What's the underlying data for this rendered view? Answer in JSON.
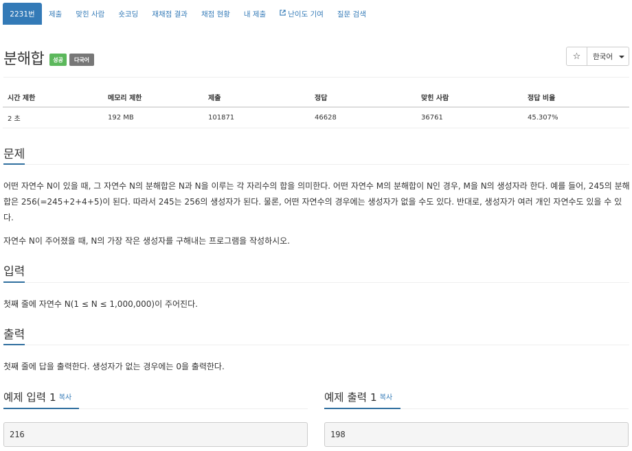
{
  "nav": {
    "items": [
      {
        "label": "2231번",
        "active": true
      },
      {
        "label": "제출"
      },
      {
        "label": "맞힌 사람"
      },
      {
        "label": "숏코딩"
      },
      {
        "label": "재채점 결과"
      },
      {
        "label": "채점 현황"
      },
      {
        "label": "내 제출"
      },
      {
        "label": "난이도 기여",
        "icon": "external-link-icon"
      },
      {
        "label": "질문 검색"
      }
    ]
  },
  "problem": {
    "title": "분해합",
    "badges": {
      "success": "성공",
      "multi": "다국어"
    },
    "star_icon": "☆",
    "language": "한국어"
  },
  "info": {
    "headers": [
      "시간 제한",
      "메모리 제한",
      "제출",
      "정답",
      "맞힌 사람",
      "정답 비율"
    ],
    "values": [
      "2 초",
      "192 MB",
      "101871",
      "46628",
      "36761",
      "45.307%"
    ]
  },
  "sections": {
    "problem_title": "문제",
    "problem_p1": "어떤 자연수 N이 있을 때, 그 자연수 N의 분해합은 N과 N을 이루는 각 자리수의 합을 의미한다. 어떤 자연수 M의 분해합이 N인 경우, M을 N의 생성자라 한다. 예를 들어, 245의 분해합은 256(=245+2+4+5)이 된다. 따라서 245는 256의 생성자가 된다. 물론, 어떤 자연수의 경우에는 생성자가 없을 수도 있다. 반대로, 생성자가 여러 개인 자연수도 있을 수 있다.",
    "problem_p2": "자연수 N이 주어졌을 때, N의 가장 작은 생성자를 구해내는 프로그램을 작성하시오.",
    "input_title": "입력",
    "input_text": "첫째 줄에 자연수 N(1 ≤ N ≤ 1,000,000)이 주어진다.",
    "output_title": "출력",
    "output_text": "첫째 줄에 답을 출력한다. 생성자가 없는 경우에는 0을 출력한다."
  },
  "samples": {
    "input_title": "예제 입력 1",
    "output_title": "예제 출력 1",
    "copy_label": "복사",
    "input_value": "216",
    "output_value": "198"
  },
  "colors": {
    "primary": "#337ab7",
    "success": "#5cb85c",
    "gray_badge": "#777777"
  }
}
